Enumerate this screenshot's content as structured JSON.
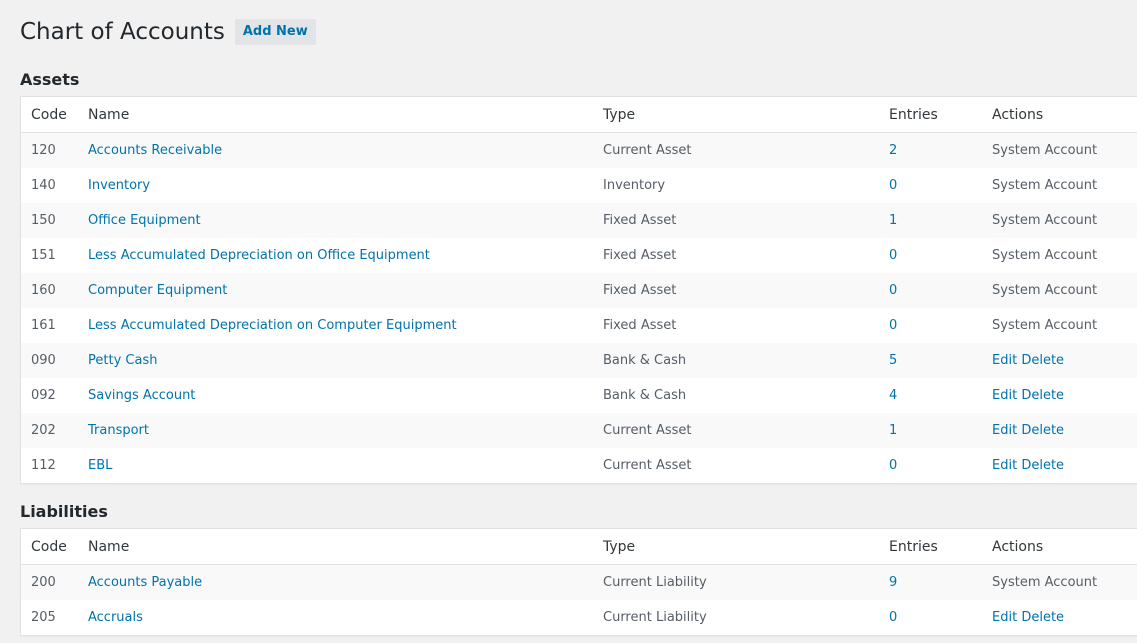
{
  "page": {
    "title": "Chart of Accounts",
    "add_new_label": "Add New"
  },
  "columns": {
    "code": "Code",
    "name": "Name",
    "type": "Type",
    "entries": "Entries",
    "actions": "Actions"
  },
  "sections": [
    {
      "title": "Assets",
      "rows": [
        {
          "code": "120",
          "name": "Accounts Receivable",
          "type": "Current Asset",
          "entries": "2",
          "action": "System Account"
        },
        {
          "code": "140",
          "name": "Inventory",
          "type": "Inventory",
          "entries": "0",
          "action": "System Account"
        },
        {
          "code": "150",
          "name": "Office Equipment",
          "type": "Fixed Asset",
          "entries": "1",
          "action": "System Account"
        },
        {
          "code": "151",
          "name": "Less Accumulated Depreciation on Office Equipment",
          "type": "Fixed Asset",
          "entries": "0",
          "action": "System Account"
        },
        {
          "code": "160",
          "name": "Computer Equipment",
          "type": "Fixed Asset",
          "entries": "0",
          "action": "System Account"
        },
        {
          "code": "161",
          "name": "Less Accumulated Depreciation on Computer Equipment",
          "type": "Fixed Asset",
          "entries": "0",
          "action": "System Account"
        },
        {
          "code": "090",
          "name": "Petty Cash",
          "type": "Bank & Cash",
          "entries": "5",
          "action": "Edit Delete"
        },
        {
          "code": "092",
          "name": "Savings Account",
          "type": "Bank & Cash",
          "entries": "4",
          "action": "Edit Delete"
        },
        {
          "code": "202",
          "name": "Transport",
          "type": "Current Asset",
          "entries": "1",
          "action": "Edit Delete"
        },
        {
          "code": "112",
          "name": "EBL",
          "type": "Current Asset",
          "entries": "0",
          "action": "Edit Delete"
        }
      ]
    },
    {
      "title": "Liabilities",
      "rows": [
        {
          "code": "200",
          "name": "Accounts Payable",
          "type": "Current Liability",
          "entries": "9",
          "action": "System Account"
        },
        {
          "code": "205",
          "name": "Accruals",
          "type": "Current Liability",
          "entries": "0",
          "action": "Edit Delete"
        }
      ]
    }
  ],
  "action_labels": {
    "edit": "Edit",
    "delete": "Delete"
  },
  "colors": {
    "link": "#0073aa",
    "background": "#f1f1f1",
    "row_alt": "#f9f9f9"
  }
}
